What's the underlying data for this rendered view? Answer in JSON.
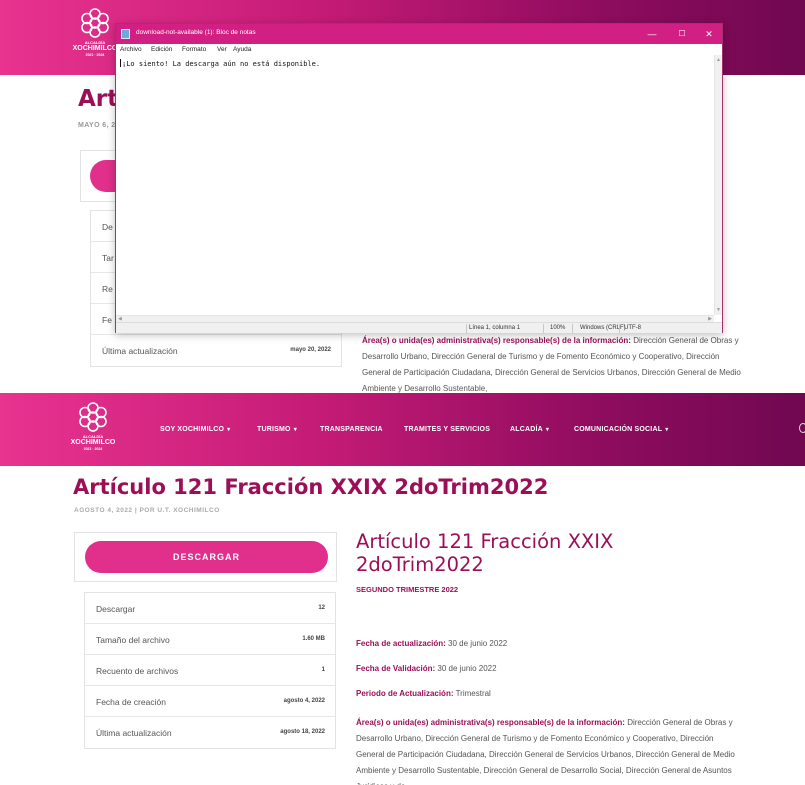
{
  "colors": {
    "brand_pink": "#e0308c",
    "brand_dark": "#9c0f57",
    "header_gradient_start": "#e8338f",
    "header_gradient_end": "#700850",
    "notepad_title_bar": "#d21f83"
  },
  "logo": {
    "line1": "ALCALDÍA",
    "line2": "XOCHIMILCO",
    "line3": "2021 · 2024",
    "icon": "flower-logo-icon"
  },
  "top_page": {
    "article_title": "Artí",
    "article_meta": "MAYO 6, 2",
    "table_rows": [
      {
        "label": "De",
        "value": ""
      },
      {
        "label": "Tar",
        "value": ""
      },
      {
        "label": "Re",
        "value": ""
      },
      {
        "label": "Fe",
        "value": ""
      },
      {
        "label": "Última actualización",
        "value": "mayo 20, 2022"
      }
    ],
    "areas_label": "Área(s) o unida(es) administrativa(s) responsable(s) de la información:",
    "areas_text": "Dirección General de Obras y Desarrollo Urbano, Dirección General de Turismo y de Fomento Económico y Cooperativo, Dirección General de Participación Ciudadana, Dirección General de Servicios Urbanos, Dirección General de Medio Ambiente y Desarrollo Sustentable,"
  },
  "notepad": {
    "title": "download-not-available (1): Bloc de notas",
    "menu": [
      "Archivo",
      "Edición",
      "Formato",
      "Ver",
      "Ayuda"
    ],
    "content": "¡Lo siento! La descarga aún no está disponible.",
    "status": {
      "position": "Línea 1, columna 1",
      "zoom": "100%",
      "line_ending": "Windows (CRLF)",
      "encoding": "UTF-8"
    },
    "controls": {
      "minimize": "—",
      "maximize": "☐",
      "close": "✕"
    }
  },
  "bottom_page": {
    "nav": [
      {
        "label": "SOY XOCHIMILCO",
        "dropdown": true
      },
      {
        "label": "TURISMO",
        "dropdown": true
      },
      {
        "label": "TRANSPARENCIA",
        "dropdown": false
      },
      {
        "label": "TRAMITES Y SERVICIOS",
        "dropdown": false
      },
      {
        "label": "ALCADÍA",
        "dropdown": true
      },
      {
        "label": "COMUNICACIÓN SOCIAL",
        "dropdown": true
      }
    ],
    "article_title": "Artículo 121 Fracción XXIX 2doTrim2022",
    "article_meta": "AGOSTO 4, 2022   |   POR U.T. XOCHIMILCO",
    "download_button": "DESCARGAR",
    "table_rows": [
      {
        "label": "Descargar",
        "value": "12"
      },
      {
        "label": "Tamaño del archivo",
        "value": "1.60 MB"
      },
      {
        "label": "Recuento de archivos",
        "value": "1"
      },
      {
        "label": "Fecha de creación",
        "value": "agosto 4, 2022"
      },
      {
        "label": "Última actualización",
        "value": "agosto 18, 2022"
      }
    ],
    "content_title": "Artículo 121 Fracción XXIX 2doTrim2022",
    "content_subtitle": "SEGUNDO TRIMESTRE 2022",
    "update_label": "Fecha de actualización:",
    "update_value": "30 de junio 2022",
    "validation_label": "Fecha de Validación:",
    "validation_value": "30 de junio 2022",
    "period_label": "Periodo de Actualización:",
    "period_value": "Trimestral",
    "areas_label": "Área(s) o unida(es) administrativa(s) responsable(s) de la información:",
    "areas_text": "Dirección General de Obras y Desarrollo Urbano, Dirección General de Turismo y de Fomento Económico y Cooperativo, Dirección General de Participación Ciudadana, Dirección General de Servicios Urbanos, Dirección General de Medio Ambiente y Desarrollo Sustentable, Dirección General de Desarrollo Social, Dirección General de Asuntos Jurídicos y de"
  }
}
